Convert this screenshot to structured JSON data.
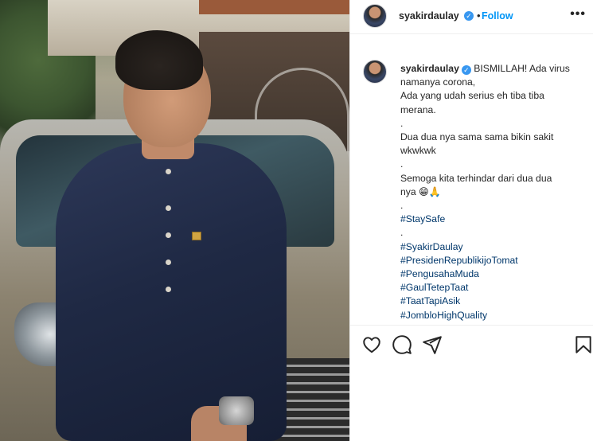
{
  "post": {
    "username": "syakirdaulay",
    "verified_mark": "✓",
    "separator": "•",
    "follow_label": "Follow",
    "more_label": "•••"
  },
  "caption": {
    "username": "syakirdaulay",
    "lines": [
      "BISMILLAH! Ada virus",
      "namanya corona,",
      "Ada yang udah serius eh tiba tiba",
      "merana.",
      ".",
      "Dua dua nya sama sama bikin sakit",
      "wkwkwk",
      ".",
      "Semoga kita terhindar dari dua dua",
      "nya 😁🙏",
      "."
    ],
    "hashtags_a": [
      "#StaySafe"
    ],
    "separator_b": ".",
    "hashtags_b": [
      "#SyakirDaulay",
      "#PresidenRepublikijoTomat",
      "#PengusahaMuda",
      "#GaulTetepTaat",
      "#TaatTapiAsik",
      "#JombloHighQuality"
    ]
  },
  "icons": {
    "like": "heart-icon",
    "comment": "comment-icon",
    "share": "share-icon",
    "save": "bookmark-icon"
  },
  "colors": {
    "link": "#00376b",
    "follow": "#0095f6",
    "verified": "#3897f0"
  }
}
